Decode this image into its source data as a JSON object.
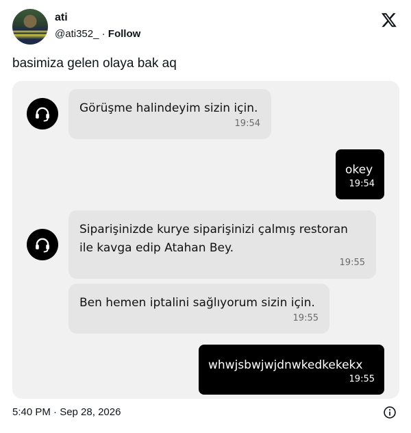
{
  "tweet": {
    "display_name": "ati",
    "handle": "@ati352_",
    "separator": " · ",
    "follow_label": "Follow",
    "text": "basimiza gelen olaya bak aq",
    "timestamp": "5:40 PM · Sep 28, 2026"
  },
  "chat": {
    "messages": [
      {
        "sender": "agent",
        "lines": [
          "Görüşme halindeyim sizin için."
        ],
        "time": "19:54"
      },
      {
        "sender": "user",
        "lines": [
          "okey"
        ],
        "time": "19:54"
      },
      {
        "sender": "agent",
        "lines": [
          "Siparişinizde kurye siparişinizi çalmış restoran",
          "ile kavga edip Atahan Bey."
        ],
        "time": "19:55"
      },
      {
        "sender": "agent",
        "lines": [
          "Ben hemen iptalini sağlıyorum sizin için."
        ],
        "time": "19:55"
      },
      {
        "sender": "user",
        "lines": [
          "whwjsbwjwjdnwkedkekekx"
        ],
        "time": "19:55"
      }
    ]
  },
  "icons": {
    "logo": "x-logo-icon",
    "agent": "headset-icon",
    "info": "info-icon"
  }
}
